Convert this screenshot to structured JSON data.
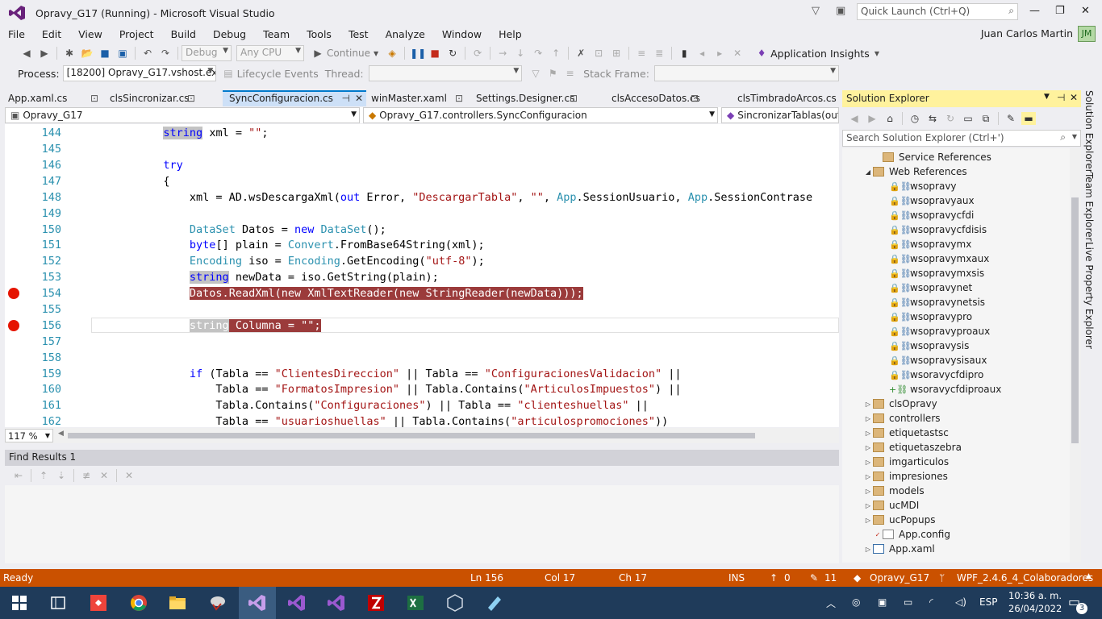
{
  "window": {
    "title": "Opravy_G17 (Running) - Microsoft Visual Studio",
    "quick_launch_placeholder": "Quick Launch (Ctrl+Q)"
  },
  "menu": {
    "items": [
      "File",
      "Edit",
      "View",
      "Project",
      "Build",
      "Debug",
      "Team",
      "Tools",
      "Test",
      "Analyze",
      "Window",
      "Help"
    ],
    "user": "Juan Carlos Martin",
    "avatar": "JM"
  },
  "toolbar": {
    "config": "Debug",
    "platform": "Any CPU",
    "continue": "Continue",
    "app_insights": "Application Insights"
  },
  "debug_bar": {
    "process_label": "Process:",
    "process_value": "[18200] Opravy_G17.vshost.exe",
    "lifecycle": "Lifecycle Events",
    "thread_label": "Thread:",
    "stack_label": "Stack Frame:"
  },
  "tabs": [
    {
      "label": "App.xaml.cs"
    },
    {
      "label": "clsSincronizar.cs"
    },
    {
      "label": "SyncConfiguracion.cs"
    },
    {
      "label": "winMaster.xaml"
    },
    {
      "label": "Settings.Designer.cs"
    },
    {
      "label": "clsAccesoDatos.cs"
    },
    {
      "label": "clsTimbradoArcos.cs"
    }
  ],
  "navbar": {
    "project": "Opravy_G17",
    "class": "Opravy_G17.controllers.SyncConfiguracion",
    "member": "SincronizarTablas(out str"
  },
  "code": {
    "line_numbers": [
      "144",
      "145",
      "146",
      "147",
      "148",
      "149",
      "150",
      "151",
      "152",
      "153",
      "154",
      "155",
      "156",
      "157",
      "158",
      "159",
      "160",
      "161",
      "162"
    ]
  },
  "editor": {
    "zoom": "117 %"
  },
  "find_results": {
    "title": "Find Results 1"
  },
  "solution_explorer": {
    "title": "Solution Explorer",
    "search_placeholder": "Search Solution Explorer (Ctrl+')",
    "items": [
      {
        "label": "Service References"
      },
      {
        "label": "Web References"
      },
      {
        "label": "wsopravy"
      },
      {
        "label": "wsopravyaux"
      },
      {
        "label": "wsopravycfdi"
      },
      {
        "label": "wsopravycfdisis"
      },
      {
        "label": "wsopravymx"
      },
      {
        "label": "wsopravymxaux"
      },
      {
        "label": "wsopravymxsis"
      },
      {
        "label": "wsopravynet"
      },
      {
        "label": "wsopravynetsis"
      },
      {
        "label": "wsopravypro"
      },
      {
        "label": "wsopravyproaux"
      },
      {
        "label": "wsopravysis"
      },
      {
        "label": "wsopravysisaux"
      },
      {
        "label": "wsoravycfdipro"
      },
      {
        "label": "wsoravycfdiproaux"
      },
      {
        "label": "clsOpravy"
      },
      {
        "label": "controllers"
      },
      {
        "label": "etiquetastsc"
      },
      {
        "label": "etiquetaszebra"
      },
      {
        "label": "imgarticulos"
      },
      {
        "label": "impresiones"
      },
      {
        "label": "models"
      },
      {
        "label": "ucMDI"
      },
      {
        "label": "ucPopups"
      },
      {
        "label": "App.config"
      },
      {
        "label": "App.xaml"
      }
    ]
  },
  "side_tabs": [
    "Solution Explorer",
    "Team Explorer",
    "Live Property Explorer"
  ],
  "status": {
    "ready": "Ready",
    "ln": "Ln 156",
    "col": "Col 17",
    "ch": "Ch 17",
    "ins": "INS",
    "up": "0",
    "edits": "11",
    "repo": "Opravy_G17",
    "branch": "WPF_2.4.6_4_Colaboradores"
  },
  "taskbar": {
    "lang": "ESP",
    "time": "10:36 a. m.",
    "date": "26/04/2022",
    "notif": "3"
  },
  "colors": {
    "accent": "#007acc",
    "status": "#ca5100",
    "breakpoint": "#e51400",
    "taskbar": "#1f3b5a",
    "se_header": "#fff29d"
  }
}
